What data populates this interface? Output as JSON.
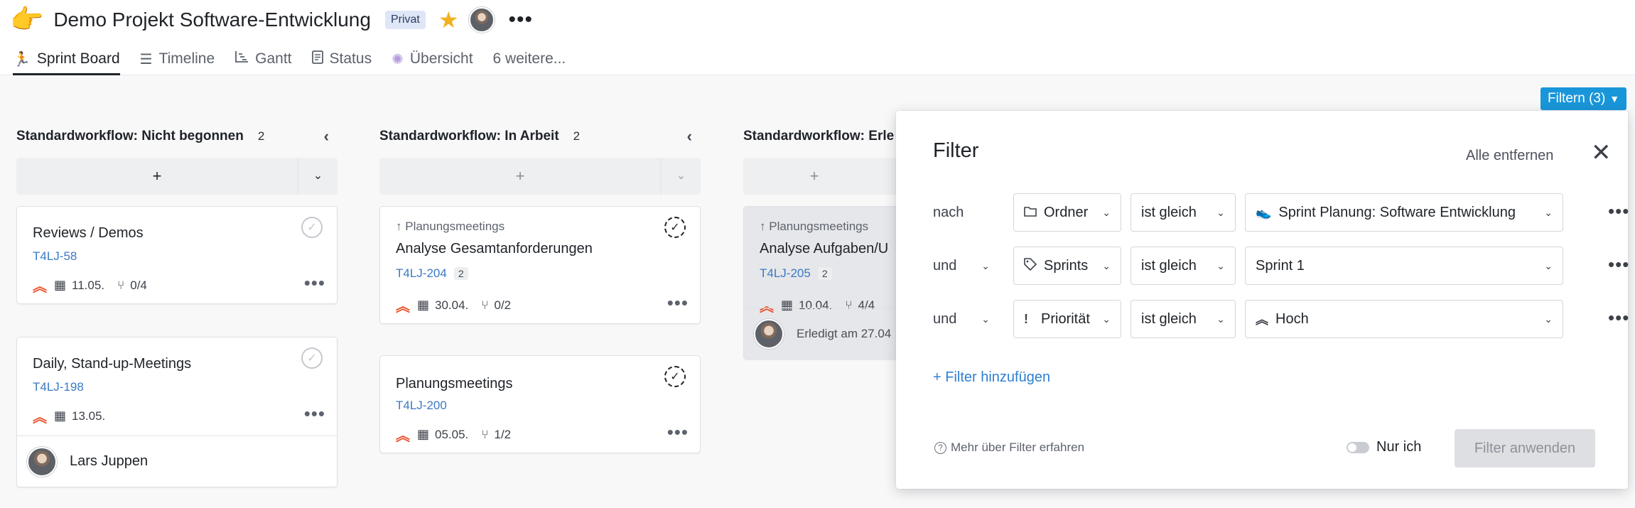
{
  "project": {
    "title": "Demo Projekt Software-Entwicklung",
    "privacy_badge": "Privat"
  },
  "tabs": [
    {
      "label": "Sprint Board",
      "icon": "sprint-runner-icon",
      "active": true
    },
    {
      "label": "Timeline",
      "icon": "list-lines-icon"
    },
    {
      "label": "Gantt",
      "icon": "gantt-chart-icon"
    },
    {
      "label": "Status",
      "icon": "status-doc-icon"
    },
    {
      "label": "Übersicht",
      "icon": "sparkle-icon"
    },
    {
      "label": "6 weitere...",
      "icon": ""
    }
  ],
  "filter_button": {
    "label": "Filtern (3)"
  },
  "columns": [
    {
      "title": "Standardworkflow: Nicht begonnen",
      "count": "2",
      "cards": [
        {
          "title": "Reviews / Demos",
          "key": "T4LJ-58",
          "date": "11.05.",
          "subtasks": "0/4"
        },
        {
          "title": "Daily, Stand-up-Meetings",
          "key": "T4LJ-198",
          "date": "13.05.",
          "assignee": "Lars Juppen"
        }
      ]
    },
    {
      "title": "Standardworkflow: In Arbeit",
      "count": "2",
      "cards": [
        {
          "parent": "Planungsmeetings",
          "title": "Analyse Gesamtanforderungen",
          "key": "T4LJ-204",
          "badge": "2",
          "date": "30.04.",
          "subtasks": "0/2"
        },
        {
          "title": "Planungsmeetings",
          "key": "T4LJ-200",
          "date": "05.05.",
          "subtasks": "1/2"
        }
      ]
    },
    {
      "title": "Standardworkflow: Erle",
      "cards": [
        {
          "parent": "Planungsmeetings",
          "title": "Analyse Aufgaben/U",
          "key": "T4LJ-205",
          "badge": "2",
          "date": "10.04.",
          "subtasks": "4/4",
          "done_text": "Erledigt am 27.04"
        }
      ]
    }
  ],
  "filter_panel": {
    "title": "Filter",
    "remove_all": "Alle entfernen",
    "rows": [
      {
        "conj": "nach",
        "field": "Ordner",
        "field_icon": "folder-icon",
        "op": "ist gleich",
        "value": "Sprint Planung: Software Entwicklung"
      },
      {
        "conj": "und",
        "field": "Sprints",
        "field_icon": "tag-icon",
        "op": "ist gleich",
        "value": "Sprint 1"
      },
      {
        "conj": "und",
        "field": "Priorität",
        "field_icon": "exclamation-icon",
        "op": "ist gleich",
        "value": "Hoch"
      }
    ],
    "add_filter": "+ Filter hinzufügen",
    "help": "Mehr über Filter erfahren",
    "only_me": "Nur ich",
    "apply": "Filter anwenden"
  },
  "colors": {
    "accent": "#1996d9",
    "priority_high": "#e8532f",
    "link": "#3b79c3"
  }
}
